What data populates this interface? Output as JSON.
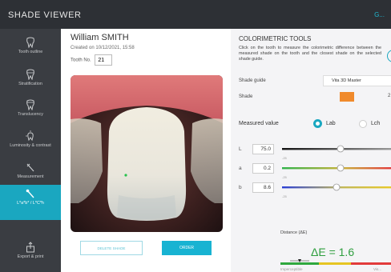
{
  "app": {
    "title": "SHADE VIEWER",
    "help_label": "G..."
  },
  "sidebar": {
    "items": [
      {
        "label": "Tooth outline",
        "icon": "tooth-outline-icon"
      },
      {
        "label": "Stratification",
        "icon": "stratification-icon"
      },
      {
        "label": "Translucency",
        "icon": "translucency-icon"
      },
      {
        "label": "Luminosity & contrast",
        "icon": "luminosity-icon"
      },
      {
        "label": "Measurement",
        "icon": "measurement-icon"
      },
      {
        "label": "L*a*b* / L*C*h",
        "icon": "lab-pipette-icon",
        "active": true
      },
      {
        "label": "Export & print",
        "icon": "export-icon"
      }
    ]
  },
  "patient": {
    "name": "William SMITH",
    "created": "Created on 10/12/2021, 15:58",
    "tooth_label": "Tooth No.",
    "tooth_no": "21"
  },
  "actions": {
    "delete": "DELETE SHADE",
    "order": "ORDER"
  },
  "colorimetric": {
    "title": "COLORIMETRIC TOOLS",
    "description": "Click on the tooth to measure the colorimetric difference between the measured shade on the tooth and the closest shade on the selected shade guide.",
    "shade_guide_label": "Shade guide",
    "shade_guide_value": "Vita 3D Master",
    "shade_label": "Shade",
    "shade_color": "#f08a2c",
    "shade_code": "2",
    "measured_label": "Measured value",
    "mode_lab": "Lab",
    "mode_lch": "Lch",
    "selected_mode": "Lab",
    "sliders": [
      {
        "axis": "L",
        "value": "75.0",
        "tick": "-25"
      },
      {
        "axis": "a",
        "value": "0.2",
        "tick": "-25"
      },
      {
        "axis": "b",
        "value": "8.6",
        "tick": "-25"
      }
    ],
    "distance_label": "Distance (ΔE)",
    "delta_e_text": "ΔE = 1.6",
    "delta_e": 1.6,
    "scale_left": "Imperceptible",
    "scale_right": "Vis..."
  }
}
